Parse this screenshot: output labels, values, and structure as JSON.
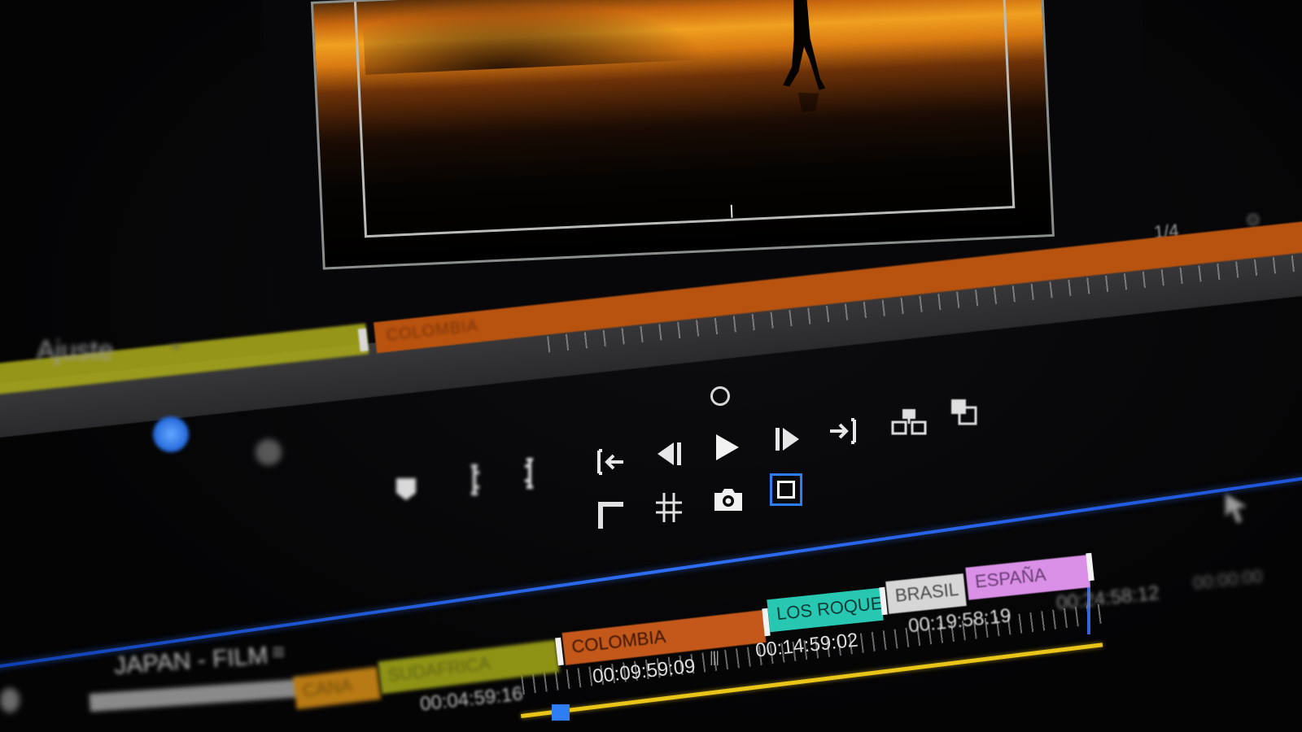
{
  "program_monitor": {
    "zoom_readout": "1/4",
    "scene": "silhouette walking on reflective salt flat at sunset"
  },
  "source_strip": {
    "label": "Ajuste",
    "clip_label": "COLOMBIA"
  },
  "transport": {
    "row1": [
      "add-marker-icon",
      "mark-in-icon",
      "mark-out-icon",
      "go-to-in-icon",
      "step-back-icon",
      "play-icon",
      "step-forward-icon",
      "go-to-out-icon",
      "insert-icon",
      "overwrite-icon"
    ],
    "row2": [
      "safe-margins-icon",
      "grid-icon",
      "camera-icon",
      "compare-view-icon"
    ]
  },
  "timeline": {
    "track_name": "JAPAN - FILM",
    "clips": [
      {
        "label": "CANA",
        "color": "#b87a14"
      },
      {
        "label": "SUDAFRICA",
        "color": "#8e9316"
      },
      {
        "label": "COLOMBIA",
        "color": "#c3581a"
      },
      {
        "label": "LOS ROQUES",
        "color": "#27c7b2"
      },
      {
        "label": "BRASIL",
        "color": "#d6d6d6"
      },
      {
        "label": "ESPAÑA",
        "color": "#d990e6"
      }
    ],
    "timecodes": [
      "00:04:59:16",
      "00:09:59:09",
      "00:14:59:02",
      "00:19:58:19",
      "00:24:58:12",
      "00:00:00"
    ]
  },
  "colors": {
    "accent_blue": "#2f7df2",
    "work_area_yellow": "#e9c51a",
    "source_olive": "#a5a51a",
    "source_orange": "#b8520f"
  }
}
